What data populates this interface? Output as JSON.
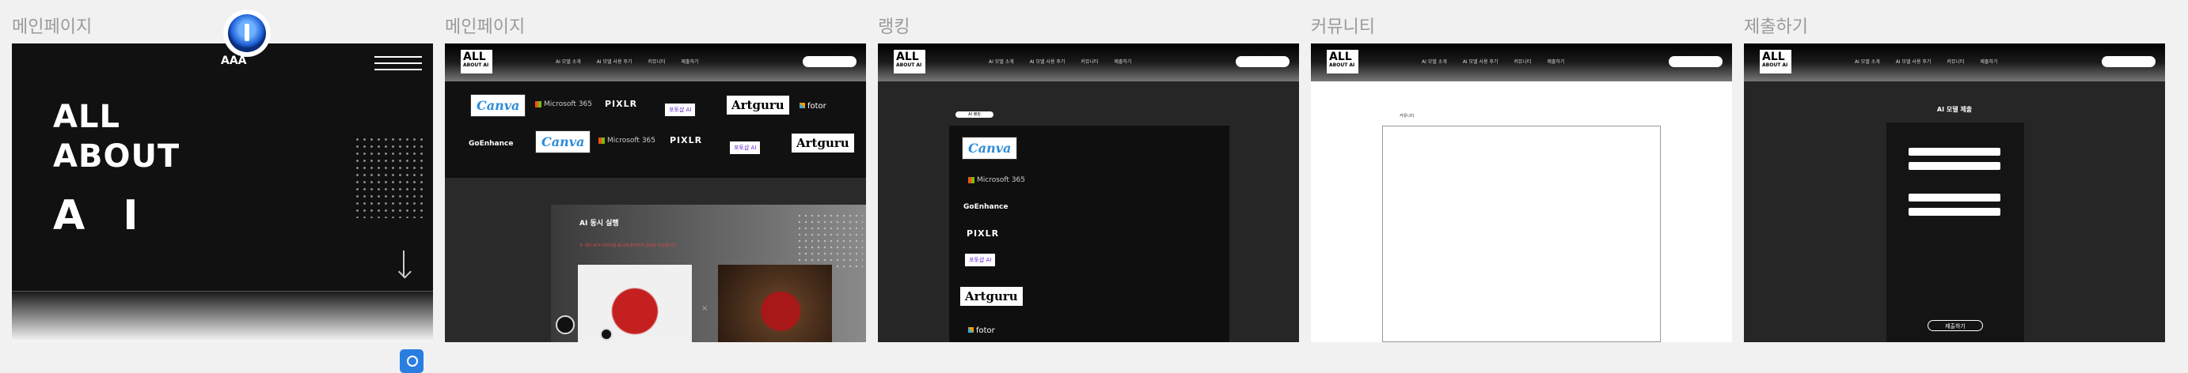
{
  "panels": [
    {
      "title": "메인페이지"
    },
    {
      "title": "메인페이지"
    },
    {
      "title": "랭킹"
    },
    {
      "title": "커뮤니티"
    },
    {
      "title": "제출하기"
    }
  ],
  "hero": {
    "brand": "AAA",
    "lines": [
      "ALL",
      "ABOUT",
      "AI"
    ]
  },
  "logo": {
    "big": "ALL",
    "small": "ABOUT AI"
  },
  "nav": [
    "AI 모델 소개",
    "AI 모델 사용 후기",
    "커뮤니티",
    "제출하기"
  ],
  "logos": {
    "canva": "Canva",
    "microsoft": "Microsoft 365",
    "pixlr": "PIXLR",
    "small_logo": "포토샵 AI",
    "artguru": "Artguru",
    "fotor": "fotor",
    "goenhance": "GoEnhance"
  },
  "card": {
    "title": "AI 동시 실행",
    "subtitle": "두 개의 AI가 이미지를 동시에 분석하여 결과를 비교합니다"
  },
  "ranking": {
    "pill": "AI 랭킹"
  },
  "community": {
    "label": "커뮤니티"
  },
  "submit": {
    "title": "AI 모델 제출",
    "button": "제출하기"
  }
}
